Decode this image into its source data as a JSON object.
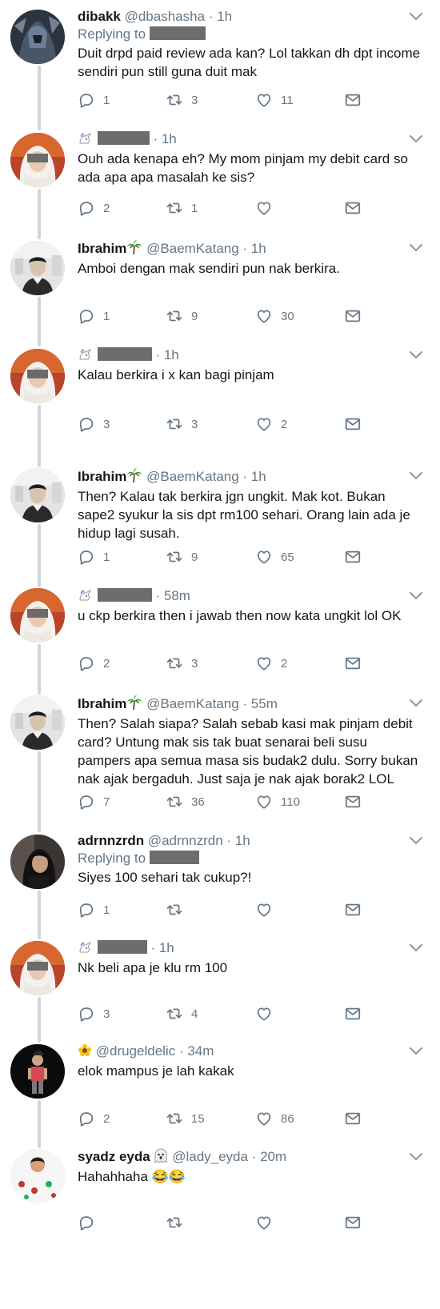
{
  "tweets": [
    {
      "name": "dibakk",
      "handle": "@dbashasha",
      "time": "· 1h",
      "replying_to": "Replying to",
      "text_lines": [
        "Duit drpd paid review ada kan? Lol takkan dh dpt income",
        "sendiri pun still guna duit mak"
      ],
      "replies": "1",
      "retweets": "3",
      "likes": "11",
      "avatar": "dark-fantasy"
    },
    {
      "name": "",
      "handle": "",
      "time": "· 1h",
      "replying_to": "",
      "text_lines": [
        "Ouh ada kenapa eh? My mom pinjam my debit card so",
        "ada apa apa masalah ke sis?"
      ],
      "replies": "2",
      "retweets": "1",
      "likes": "",
      "avatar": "hijab"
    },
    {
      "name": "Ibrahim",
      "handle": "@BaemKatang",
      "time": "· 1h",
      "replying_to": "",
      "text_lines": [
        "Amboi dengan mak sendiri pun nak berkira."
      ],
      "replies": "1",
      "retweets": "9",
      "likes": "30",
      "avatar": "boy"
    },
    {
      "name": "",
      "handle": "",
      "time": "· 1h",
      "replying_to": "",
      "text_lines": [
        "Kalau berkira i x kan bagi pinjam"
      ],
      "replies": "3",
      "retweets": "3",
      "likes": "2",
      "avatar": "hijab"
    },
    {
      "name": "Ibrahim",
      "handle": "@BaemKatang",
      "time": "· 1h",
      "replying_to": "",
      "text_lines": [
        "Then? Kalau tak berkira jgn ungkit. Mak kot. Bukan",
        "sape2 syukur la sis dpt rm100 sehari. Orang lain ada je",
        "hidup lagi susah."
      ],
      "replies": "1",
      "retweets": "9",
      "likes": "65",
      "avatar": "boy"
    },
    {
      "name": "",
      "handle": "",
      "time": "· 58m",
      "replying_to": "",
      "text_lines": [
        "u ckp berkira then i jawab then now kata ungkit lol OK"
      ],
      "replies": "2",
      "retweets": "3",
      "likes": "2",
      "avatar": "hijab"
    },
    {
      "name": "Ibrahim",
      "handle": "@BaemKatang",
      "time": "· 55m",
      "replying_to": "",
      "text_lines": [
        "Then? Salah siapa? Salah sebab kasi mak pinjam debit",
        "card? Untung mak sis tak buat senarai beli susu",
        "pampers apa semua masa sis budak2 dulu. Sorry bukan",
        "nak ajak bergaduh. Just saja je nak ajak borak2 LOL"
      ],
      "replies": "7",
      "retweets": "36",
      "likes": "110",
      "avatar": "boy"
    },
    {
      "name": "adrnnzrdn",
      "handle": "@adrnnzrdn",
      "time": "· 1h",
      "replying_to": "Replying to",
      "text_lines": [
        "Siyes 100 sehari tak cukup?!"
      ],
      "replies": "1",
      "retweets": "",
      "likes": "",
      "avatar": "dark-girl"
    },
    {
      "name": "",
      "handle": "",
      "time": "· 1h",
      "replying_to": "",
      "text_lines": [
        "Nk beli apa je klu rm 100"
      ],
      "replies": "3",
      "retweets": "4",
      "likes": "",
      "avatar": "hijab"
    },
    {
      "name": "",
      "handle": "@drugeldelic",
      "time": "· 34m",
      "replying_to": "",
      "text_lines": [
        "elok mampus je lah kakak"
      ],
      "replies": "2",
      "retweets": "15",
      "likes": "86",
      "avatar": "black-figure"
    },
    {
      "name": "syadz eyda",
      "handle": "@lady_eyda",
      "time": "· 20m",
      "replying_to": "",
      "text_lines": [
        "Hahahhaha 😂😂"
      ],
      "replies": "",
      "retweets": "",
      "likes": "",
      "avatar": "dots"
    }
  ],
  "icons": {
    "reply": "reply-icon",
    "retweet": "retweet-icon",
    "like": "like-icon",
    "dm": "direct-message-icon",
    "caret": "chevron-down-icon",
    "palm": "palm-tree-emoji",
    "flower": "flower-emoji",
    "ghost": "ghost-emoji",
    "unicorn": "unicorn-emoji"
  },
  "colors": {
    "text": "#14171a",
    "secondary": "#657786",
    "link": "#1b95e0",
    "thread_line": "#cfd6dc"
  }
}
